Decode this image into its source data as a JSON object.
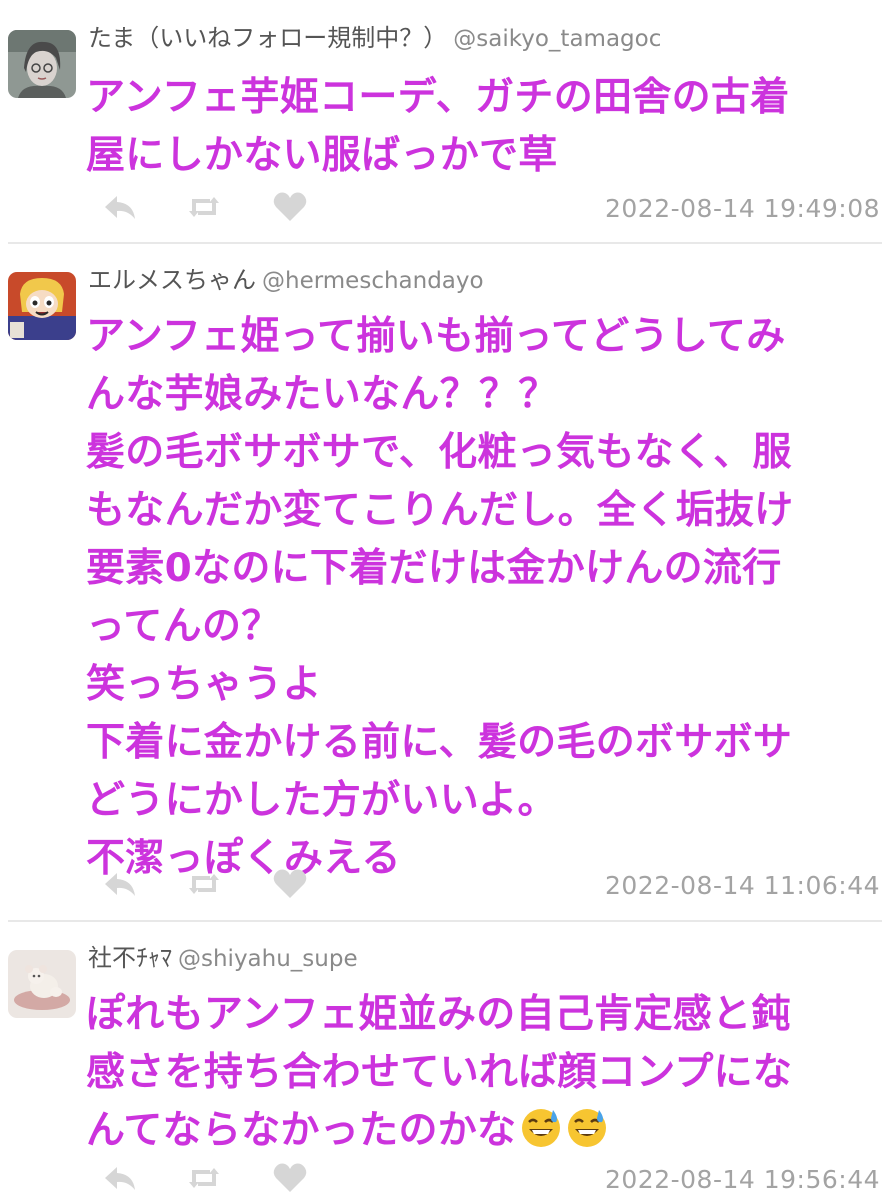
{
  "tweets": [
    {
      "display_name": "たま（いいねフォロー規制中？）",
      "handle": "@saikyo_tamagoc",
      "body_lines": [
        "アンフェ芋姫コーデ、ガチの田舎の古着",
        "屋にしかない服ばっかで草"
      ],
      "timestamp": "2022-08-14 19:49:08",
      "avatar_icon": "user-avatar-icon"
    },
    {
      "display_name": "エルメスちゃん",
      "handle": "@hermeschandayo",
      "body_lines": [
        "アンフェ姫って揃いも揃ってどうしてみ",
        "んな芋娘みたいなん？？？",
        "髪の毛ボサボサで、化粧っ気もなく、服",
        "もなんだか変てこりんだし。全く垢抜け",
        "要素0なのに下着だけは金かけんの流行",
        "ってんの？",
        "笑っちゃうよ",
        "下着に金かける前に、髪の毛のボサボサ",
        "どうにかした方がいいよ。",
        "不潔っぽくみえる"
      ],
      "timestamp": "2022-08-14 11:06:44",
      "avatar_icon": "user-avatar-icon"
    },
    {
      "display_name": "社不ﾁｬﾏ",
      "handle": "@shiyahu_supe",
      "body_lines": [
        "ぽれもアンフェ姫並みの自己肯定感と鈍",
        "感さを持ち合わせていれば顔コンプにな",
        "んてならなかったのかな"
      ],
      "timestamp": "2022-08-14 19:56:44",
      "avatar_icon": "user-avatar-icon",
      "trailing_emoji": [
        "grinning-sweat-emoji",
        "grinning-sweat-emoji"
      ]
    }
  ],
  "icons": {
    "reply": "reply-icon",
    "retweet": "retweet-icon",
    "like": "heart-icon"
  },
  "colors": {
    "body_text": "#cc33dd",
    "meta_text": "#a3a3a3",
    "action_icon": "#d6d6d6",
    "divider": "#e8e8e8"
  }
}
